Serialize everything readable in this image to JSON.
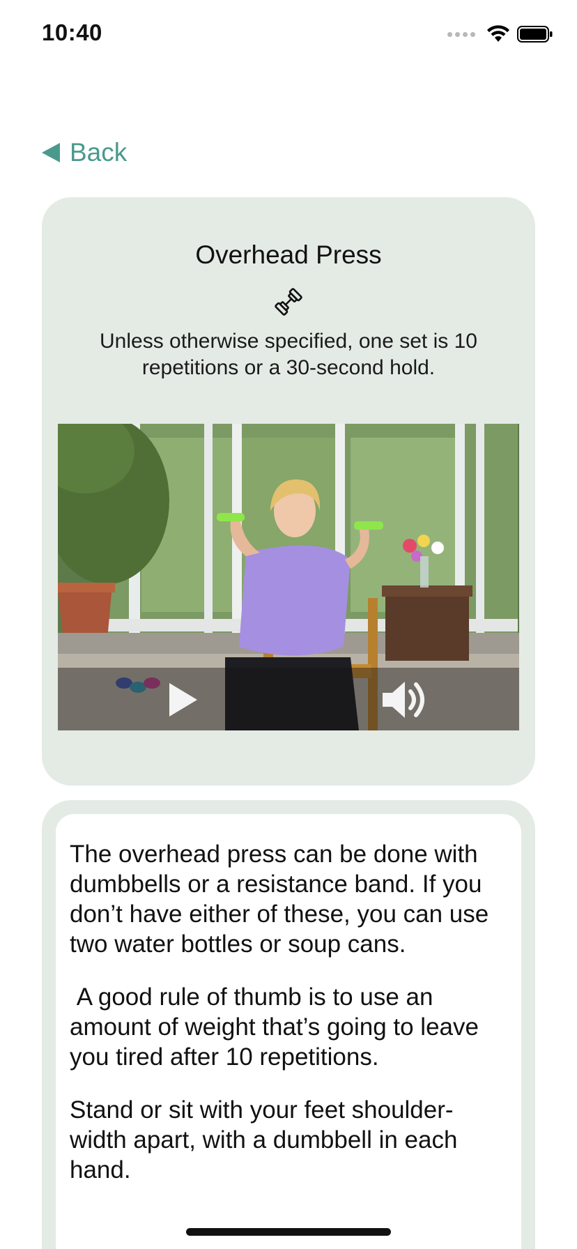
{
  "status_bar": {
    "time": "10:40"
  },
  "nav": {
    "back_label": "Back"
  },
  "exercise": {
    "title": "Overhead Press",
    "equipment_icon": "dumbbell-icon",
    "set_note": "Unless otherwise specified, one set is 10 repetitions or a 30-second hold."
  },
  "video": {
    "play_icon": "play-icon",
    "volume_icon": "speaker-volume-icon"
  },
  "description": {
    "paragraphs": [
      "The overhead press can be done with dumbbells or a resistance band.  If you don’t have either of these, you can use two water bottles or soup cans.",
      " A good rule of thumb is to use an amount of weight that’s going to leave you tired after 10 repetitions.",
      "Stand or sit with your feet shoulder-width apart, with a dumbbell in each hand."
    ]
  },
  "colors": {
    "accent": "#4a9a8c",
    "card_background": "#e4ebe5"
  }
}
